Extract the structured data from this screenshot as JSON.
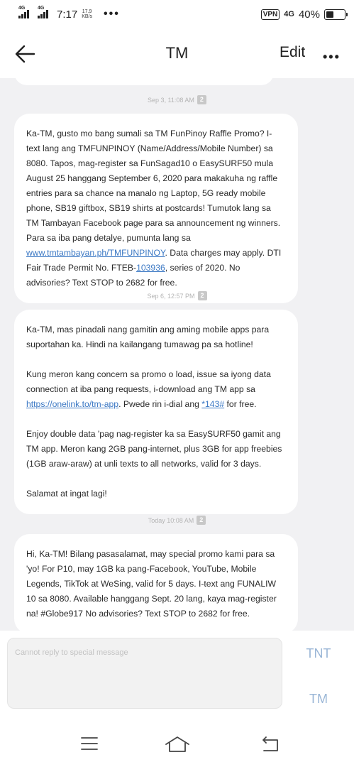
{
  "status_bar": {
    "left_signal_1": "4G",
    "left_signal_2": "4G",
    "time": "7:17",
    "speed_value": "17.9",
    "speed_unit": "KB/s",
    "vpn": "VPN",
    "network": "4G",
    "battery": "40%",
    "battery_level": 0.4
  },
  "header": {
    "title": "TM",
    "edit_label": "Edit"
  },
  "messages": [
    {
      "timestamp": "Sep 3, 11:08 AM",
      "sim": "2",
      "paragraphs": [
        [
          {
            "text": "Ka-TM, gusto mo bang sumali sa TM FunPinoy Raffle Promo? I-text lang ang TMFUNPINOY (Name/Address/Mobile Number) sa 8080. Tapos, mag-register sa FunSagad10 o EasySURF50 mula August 25 hanggang September 6, 2020 para makakuha ng raffle entries para sa chance na manalo ng Laptop, 5G ready mobile phone, SB19 giftbox, SB19 shirts at postcards! Tumutok lang sa TM Tambayan Facebook page para sa announcement ng winners. Para sa iba pang detalye, pumunta lang sa "
          },
          {
            "text": "www.tmtambayan.ph/TMFUNPINOY",
            "link": true
          },
          {
            "text": ". Data charges may apply. DTI Fair Trade Permit No. FTEB-"
          },
          {
            "text": "103936",
            "link": true
          },
          {
            "text": ", series of 2020. No advisories? Text STOP to 2682 for free."
          }
        ]
      ]
    },
    {
      "timestamp": "Sep 6, 12:57 PM",
      "sim": "2",
      "paragraphs": [
        [
          {
            "text": "Ka-TM, mas pinadali nang gamitin ang aming mobile apps para suportahan ka. Hindi na kailangang tumawag pa sa hotline!"
          }
        ],
        [
          {
            "text": "Kung meron kang concern sa promo o load, issue sa iyong data connection at iba pang requests, i-download ang TM app sa "
          },
          {
            "text": "https://onelink.to/tm-app",
            "link": true
          },
          {
            "text": ". Pwede rin i-dial ang "
          },
          {
            "text": "*143#",
            "link": true
          },
          {
            "text": " for free."
          }
        ],
        [
          {
            "text": "Enjoy double data 'pag nag-register ka sa EasySURF50 gamit ang TM app. Meron kang 2GB pang-internet, plus 3GB for app freebies (1GB araw-araw) at unli texts to all networks, valid for 3 days."
          }
        ],
        [
          {
            "text": "Salamat at ingat lagi!"
          }
        ]
      ]
    },
    {
      "timestamp": "Today 10:08 AM",
      "sim": "2",
      "paragraphs": [
        [
          {
            "text": "Hi, Ka-TM! Bilang pasasalamat, may special promo kami para sa 'yo! For P10, may 1GB ka pang-Facebook, YouTube, Mobile Legends, TikTok at WeSing, valid for 5 days. I-text ang FUNALIW 10 sa 8080. Available hanggang Sept. 20 lang, kaya mag-register na! #Globe917 No advisories? Text STOP to 2682 for free."
          }
        ]
      ]
    }
  ],
  "composer": {
    "placeholder": "Cannot reply to special message",
    "sim1_label": "TNT",
    "sim2_label": "TM"
  },
  "colors": {
    "link": "#3b78c4",
    "sim_button": "#9ab6d6",
    "background": "#f1f1f3"
  }
}
